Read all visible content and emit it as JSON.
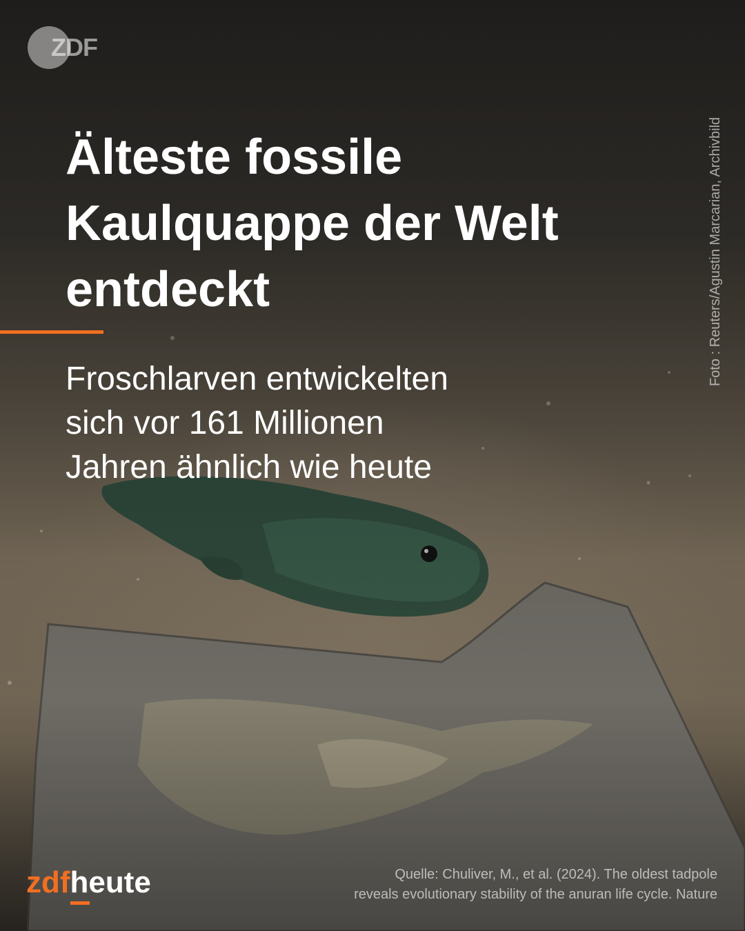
{
  "branding": {
    "channel_logo": "ZDF",
    "brand_part1": "zdf",
    "brand_part2": "heute",
    "accent_color": "#f26f21"
  },
  "headline": "Älteste fossile\nKaulquappe der Welt\nentdeckt",
  "subheadline": "Froschlarven entwickelten\nsich vor 161 Millionen\nJahren ähnlich wie heute",
  "photo_credit": "Foto : Reuters/Agustin Marcarian, Archivbild",
  "source": "Quelle: Chuliver, M., et al. (2024). The oldest tadpole\nreveals evolutionary stability of the anuran life cycle. Nature"
}
